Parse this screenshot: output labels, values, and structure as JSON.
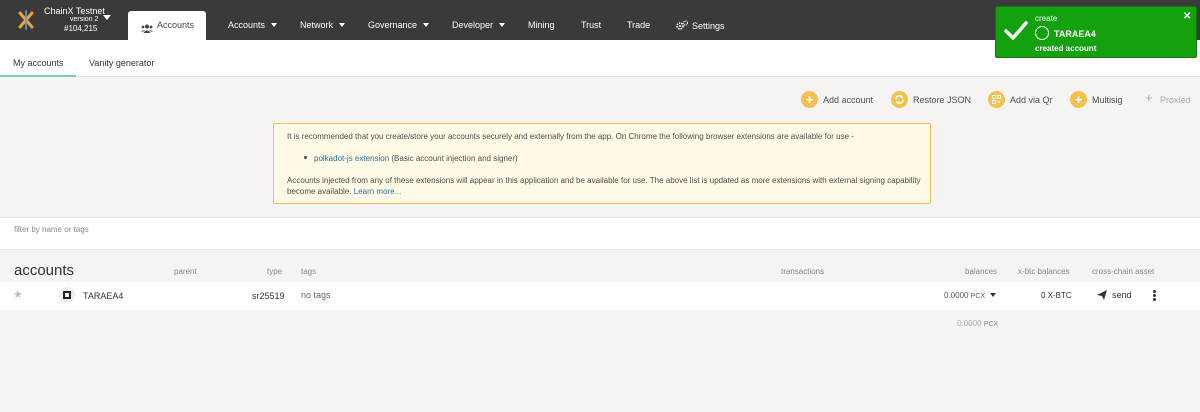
{
  "header": {
    "chain_name": "ChainX Testnet",
    "version": "version 2",
    "block": "#104,215",
    "active_tab": "Accounts",
    "nav": [
      {
        "label": "Accounts",
        "caret": true
      },
      {
        "label": "Network",
        "caret": true
      },
      {
        "label": "Governance",
        "caret": true
      },
      {
        "label": "Developer",
        "caret": true
      },
      {
        "label": "Mining",
        "caret": false
      },
      {
        "label": "Trust",
        "caret": false
      },
      {
        "label": "Trade",
        "caret": false
      },
      {
        "label": "Settings",
        "caret": false
      }
    ]
  },
  "subtabs": [
    "My accounts",
    "Vanity generator"
  ],
  "actions": {
    "add_account": "Add account",
    "restore_json": "Restore JSON",
    "add_via_qr": "Add via Qr",
    "multisig": "Multisig",
    "proxied": "Proxied"
  },
  "banner": {
    "line1": "It is recommended that you create/store your accounts securely and externally from the app. On Chrome the following browser extensions are available for use -",
    "ext_link": "polkadot-js extension",
    "ext_desc": " (Basic account injection and signer)",
    "line3": "Accounts injected from any of these extensions will appear in this application and be available for use. The above list is updated as more extensions with external signing capability become available.",
    "learn_more": "Learn more..."
  },
  "filter": {
    "placeholder": "filter by name or tags"
  },
  "table": {
    "title": "accounts",
    "headers": {
      "parent": "parent",
      "type": "type",
      "tags": "tags",
      "transactions": "transactions",
      "balances": "balances",
      "xbtc": "x-btc balances",
      "crosschain": "cross-chain asset"
    },
    "rows": [
      {
        "name": "TARAEA4",
        "type": "sr25519",
        "tags": "no tags",
        "balance": "0.0000",
        "balance_unit": "PCX",
        "xbtc": "0 X-BTC",
        "send": "send"
      }
    ],
    "total": "0.0000",
    "total_unit": "PCX"
  },
  "toast": {
    "action": "create",
    "account": "TARAEA4",
    "message": "created account"
  },
  "colors": {
    "topbar": "#3a3a3a",
    "accent": "#f2c14e",
    "toast": "#13a10e",
    "link": "#2b6f9e"
  }
}
